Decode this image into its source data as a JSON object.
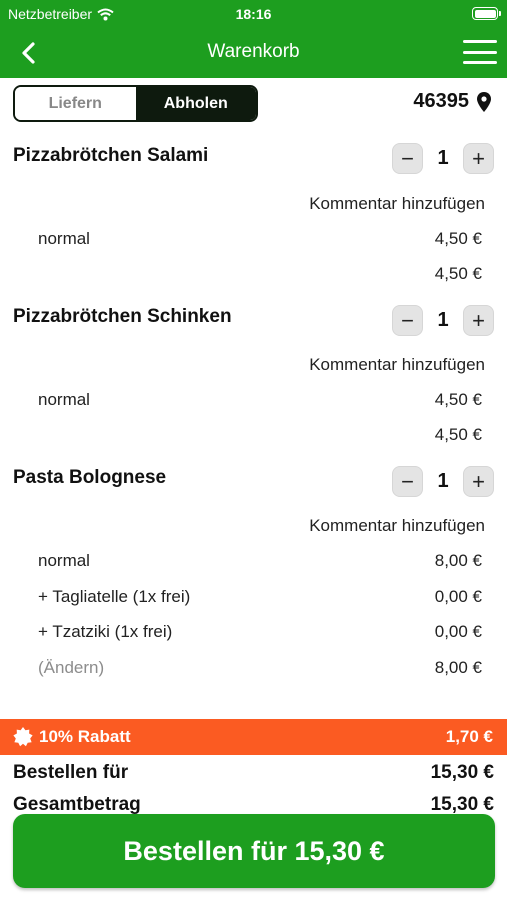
{
  "statusbar": {
    "carrier": "Netzbetreiber",
    "time": "18:16"
  },
  "navbar": {
    "title": "Warenkorb"
  },
  "delivery_toggle": {
    "options": [
      "Liefern",
      "Abholen"
    ],
    "selected": "Abholen"
  },
  "location": {
    "zip": "46395"
  },
  "cart": {
    "items": [
      {
        "name": "Pizzabrötchen Salami",
        "quantity": "1",
        "comment_label": "Kommentar hinzufügen",
        "options": [
          {
            "label": "normal",
            "price": "4,50 €"
          }
        ],
        "subtotal": "4,50 €"
      },
      {
        "name": "Pizzabrötchen Schinken",
        "quantity": "1",
        "comment_label": "Kommentar hinzufügen",
        "options": [
          {
            "label": "normal",
            "price": "4,50 €"
          }
        ],
        "subtotal": "4,50 €"
      },
      {
        "name": "Pasta Bolognese",
        "quantity": "1",
        "comment_label": "Kommentar hinzufügen",
        "options": [
          {
            "label": "normal",
            "price": "8,00 €"
          },
          {
            "label": "+ Tagliatelle (1x frei)",
            "price": "0,00 €"
          },
          {
            "label": "+ Tzatziki (1x frei)",
            "price": "0,00 €"
          }
        ],
        "change_label": "(Ändern)",
        "subtotal": "8,00 €"
      }
    ]
  },
  "discount": {
    "label": "10% Rabatt",
    "amount": "1,70 €"
  },
  "totals": {
    "order_label": "Bestellen für",
    "order_value": "15,30 €",
    "total_label": "Gesamtbetrag",
    "total_value": "15,30 €"
  },
  "cta": {
    "label": "Bestellen für 15,30 €"
  },
  "colors": {
    "brand_green": "#1d9e1f",
    "discount_orange": "#fb5b22",
    "dark": "#0e1a0e"
  }
}
